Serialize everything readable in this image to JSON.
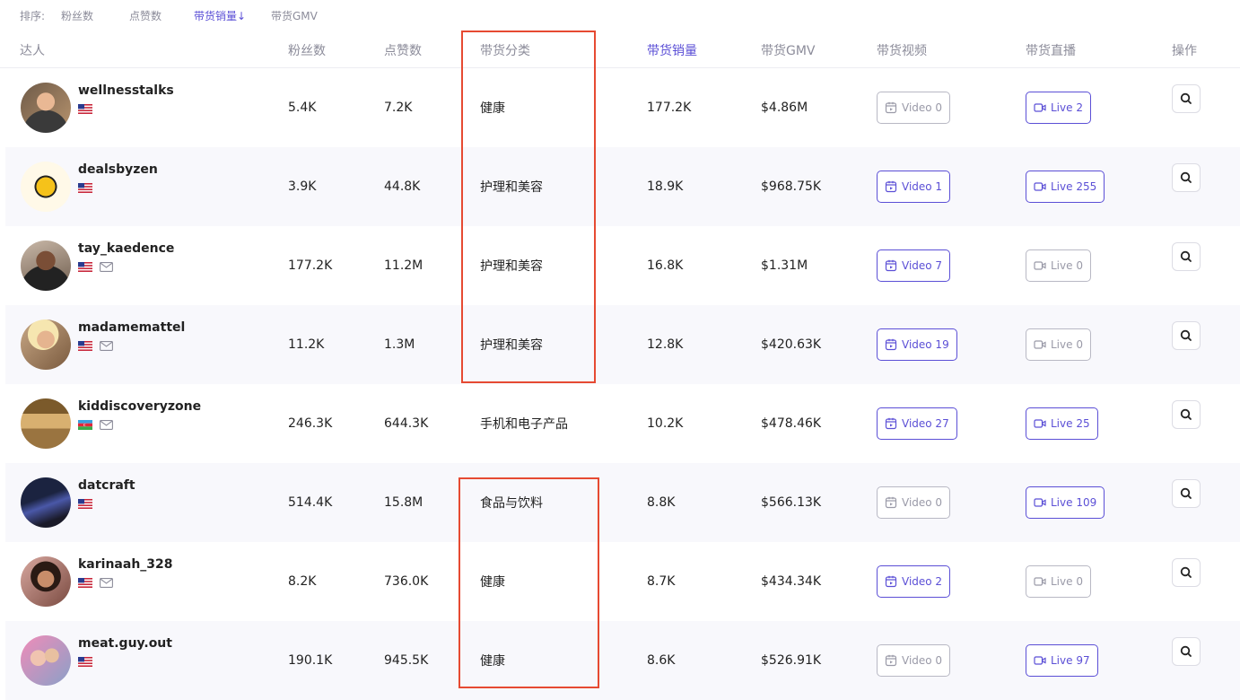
{
  "sort": {
    "label": "排序:",
    "options": [
      "粉丝数",
      "点赞数",
      "带货销量↓",
      "带货GMV"
    ],
    "active_index": 2
  },
  "columns": {
    "creator": "达人",
    "followers": "粉丝数",
    "likes": "点赞数",
    "category": "带货分类",
    "sales": "带货销量",
    "gmv": "带货GMV",
    "videos": "带货视频",
    "live": "带货直播",
    "action": "操作"
  },
  "rows": [
    {
      "name": "wellnesstalks",
      "flag": "US",
      "email": false,
      "followers": "5.4K",
      "likes": "7.2K",
      "category": "健康",
      "sales": "177.2K",
      "gmv": "$4.86M",
      "video": "Video 0",
      "video_active": false,
      "live": "Live 2",
      "live_active": true
    },
    {
      "name": "dealsbyzen",
      "flag": "US",
      "email": false,
      "followers": "3.9K",
      "likes": "44.8K",
      "category": "护理和美容",
      "sales": "18.9K",
      "gmv": "$968.75K",
      "video": "Video 1",
      "video_active": true,
      "live": "Live 255",
      "live_active": true
    },
    {
      "name": "tay_kaedence",
      "flag": "US",
      "email": true,
      "followers": "177.2K",
      "likes": "11.2M",
      "category": "护理和美容",
      "sales": "16.8K",
      "gmv": "$1.31M",
      "video": "Video 7",
      "video_active": true,
      "live": "Live 0",
      "live_active": false
    },
    {
      "name": "madamemattel",
      "flag": "US",
      "email": true,
      "followers": "11.2K",
      "likes": "1.3M",
      "category": "护理和美容",
      "sales": "12.8K",
      "gmv": "$420.63K",
      "video": "Video 19",
      "video_active": true,
      "live": "Live 0",
      "live_active": false
    },
    {
      "name": "kiddiscoveryzone",
      "flag": "AZ",
      "email": true,
      "followers": "246.3K",
      "likes": "644.3K",
      "category": "手机和电子产品",
      "sales": "10.2K",
      "gmv": "$478.46K",
      "video": "Video 27",
      "video_active": true,
      "live": "Live 25",
      "live_active": true
    },
    {
      "name": "datcraft",
      "flag": "US",
      "email": false,
      "followers": "514.4K",
      "likes": "15.8M",
      "category": "食品与饮料",
      "sales": "8.8K",
      "gmv": "$566.13K",
      "video": "Video 0",
      "video_active": false,
      "live": "Live 109",
      "live_active": true
    },
    {
      "name": "karinaah_328",
      "flag": "US",
      "email": true,
      "followers": "8.2K",
      "likes": "736.0K",
      "category": "健康",
      "sales": "8.7K",
      "gmv": "$434.34K",
      "video": "Video 2",
      "video_active": true,
      "live": "Live 0",
      "live_active": false
    },
    {
      "name": "meat.guy.out",
      "flag": "US",
      "email": false,
      "followers": "190.1K",
      "likes": "945.5K",
      "category": "健康",
      "sales": "8.6K",
      "gmv": "$526.91K",
      "video": "Video 0",
      "video_active": false,
      "live": "Live 97",
      "live_active": true
    }
  ],
  "colors": {
    "accent": "#5b4fd6",
    "inactive": "#9a9aa8",
    "highlight": "#e64a32",
    "row_alt": "#f8f8fc"
  }
}
